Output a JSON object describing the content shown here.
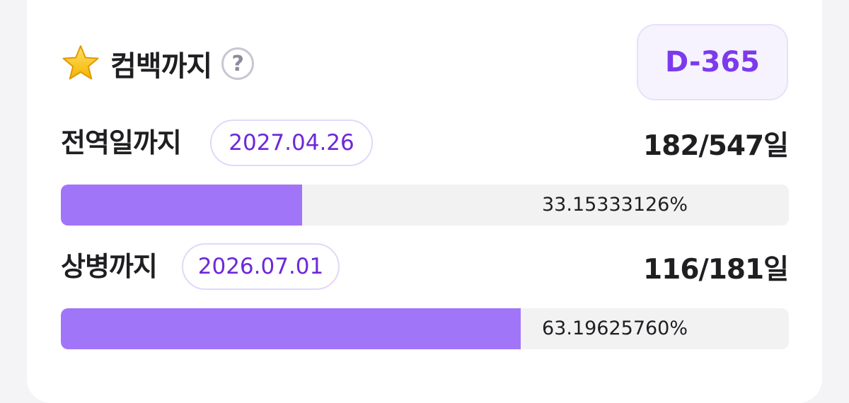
{
  "header": {
    "title": "컴백까지",
    "star_icon": "star-icon",
    "help_symbol": "?",
    "dday": "D-365"
  },
  "rows": [
    {
      "label": "전역일까지",
      "date": "2027.04.26",
      "count": "182/547일",
      "percent_text": "33.15333126%",
      "progress": 0.3315
    },
    {
      "label": "상병까지",
      "date": "2026.07.01",
      "count": "116/181일",
      "percent_text": "63.19625760%",
      "progress": 0.632
    }
  ],
  "colors": {
    "accent": "#7c3aed",
    "bar_fill": "#a175f7",
    "bar_track": "#f2f2f3",
    "badge_bg": "#f6f3fe"
  }
}
